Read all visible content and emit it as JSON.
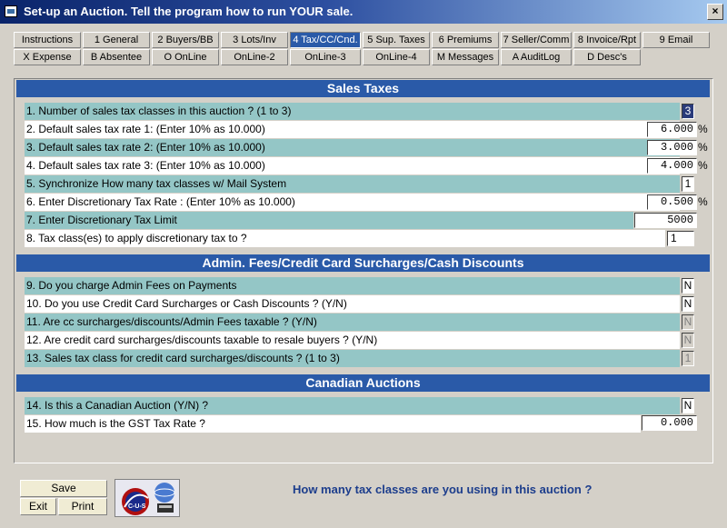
{
  "window": {
    "title": "Set-up an Auction.  Tell the program how to run YOUR sale.",
    "close_glyph": "×"
  },
  "tabs_row1": [
    "Instructions",
    "1 General",
    "2 Buyers/BB",
    "3 Lots/Inv",
    "4 Tax/CC/Cnd.",
    "5 Sup. Taxes",
    "6 Premiums",
    "7 Seller/Comm",
    "8 Invoice/Rpt",
    "9 Email"
  ],
  "tabs_row2": [
    "X Expense",
    "B Absentee",
    "O OnLine",
    "OnLine-2",
    "OnLine-3",
    "OnLine-4",
    "M Messages",
    "A AuditLog",
    "D Desc's"
  ],
  "active_tab": "4 Tax/CC/Cnd.",
  "sections": {
    "sales_taxes": "Sales Taxes",
    "admin_fees": "Admin. Fees/Credit Card Surcharges/Cash Discounts",
    "canadian": "Canadian Auctions"
  },
  "rows": [
    {
      "label": "1. Number of sales tax classes in this auction ? (1 to 3)",
      "value": "3",
      "suffix": ""
    },
    {
      "label": "2. Default sales tax rate 1: (Enter 10% as 10.000)",
      "value": "6.000",
      "suffix": "%"
    },
    {
      "label": "3. Default sales tax rate 2: (Enter 10% as 10.000)",
      "value": "3.000",
      "suffix": "%"
    },
    {
      "label": "4. Default sales tax rate 3: (Enter 10% as 10.000)",
      "value": "4.000",
      "suffix": "%"
    },
    {
      "label": "5. Synchronize How many tax classes w/ Mail System",
      "value": "1",
      "suffix": ""
    },
    {
      "label": "6. Enter Discretionary Tax Rate : (Enter 10% as 10.000)",
      "value": "0.500",
      "suffix": "%"
    },
    {
      "label": "7. Enter Discretionary Tax Limit",
      "value": "5000",
      "suffix": ""
    },
    {
      "label": "8. Tax class(es) to apply discretionary tax to ?",
      "value": "1",
      "suffix": ""
    },
    {
      "label": "9. Do you charge Admin Fees on Payments",
      "value": "N",
      "suffix": ""
    },
    {
      "label": "10. Do you use Credit Card Surcharges or Cash Discounts ? (Y/N)",
      "value": "N",
      "suffix": ""
    },
    {
      "label": "11. Are cc surcharges/discounts/Admin Fees taxable ? (Y/N)",
      "value": "N",
      "suffix": ""
    },
    {
      "label": "12. Are credit card surcharges/discounts taxable to resale buyers ? (Y/N)",
      "value": "N",
      "suffix": ""
    },
    {
      "label": "13. Sales tax class for credit card surcharges/discounts ? (1 to 3)",
      "value": "1",
      "suffix": ""
    },
    {
      "label": "14. Is this a Canadian Auction (Y/N) ?",
      "value": "N",
      "suffix": ""
    },
    {
      "label": "15. How much is the GST Tax Rate ?",
      "value": "0.000",
      "suffix": ""
    }
  ],
  "buttons": {
    "save": "Save",
    "exit": "Exit",
    "print": "Print"
  },
  "logo_text": "C-U-S",
  "prompt": "How many tax classes are you using in this auction ?",
  "colors": {
    "title_start": "#0a246a",
    "header": "#2a5aa8",
    "row_teal": "#94c6c6",
    "prompt": "#1c3d8c"
  }
}
